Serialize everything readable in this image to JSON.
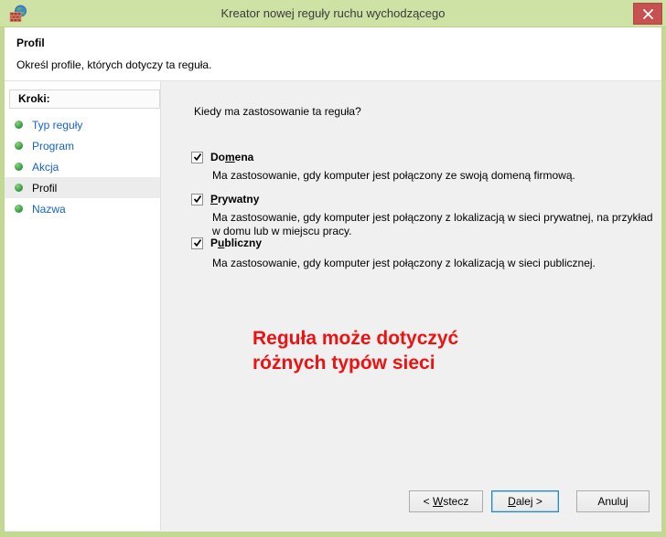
{
  "window": {
    "title": "Kreator nowej reguły ruchu wychodzącego"
  },
  "header": {
    "title": "Profil",
    "subtitle": "Określ profile, których dotyczy ta reguła."
  },
  "sidebar": {
    "heading": "Kroki:",
    "items": [
      {
        "label": "Typ reguły",
        "state": "link"
      },
      {
        "label": "Program",
        "state": "link"
      },
      {
        "label": "Akcja",
        "state": "link"
      },
      {
        "label": "Profil",
        "state": "current"
      },
      {
        "label": "Nazwa",
        "state": "link"
      }
    ]
  },
  "main": {
    "question": "Kiedy ma zastosowanie ta reguła?",
    "profiles": [
      {
        "label": "Domena",
        "label_pre": "Do",
        "label_accel": "m",
        "label_post": "ena",
        "checked": true,
        "description": "Ma zastosowanie, gdy komputer jest połączony ze swoją domeną firmową."
      },
      {
        "label": "Prywatny",
        "label_pre": "",
        "label_accel": "P",
        "label_post": "rywatny",
        "checked": true,
        "description": "Ma zastosowanie, gdy komputer jest połączony z lokalizacją w sieci prywatnej, na przykład w domu lub w miejscu pracy."
      },
      {
        "label": "Publiczny",
        "label_pre": "P",
        "label_accel": "u",
        "label_post": "bliczny",
        "checked": true,
        "description": "Ma zastosowanie, gdy komputer jest połączony z lokalizacją w sieci publicznej."
      }
    ],
    "annotation": {
      "line1": "Reguła może dotyczyć",
      "line2": "różnych typów sieci",
      "color": "#ee1111"
    }
  },
  "buttons": {
    "back": {
      "pre": "< ",
      "accel": "W",
      "post": "stecz"
    },
    "next": {
      "pre": "",
      "accel": "D",
      "post": "alej >"
    },
    "cancel": {
      "label": "Anuluj"
    }
  },
  "colors": {
    "titlebar": "#cfe2a5",
    "frame": "#c3d893",
    "close_button": "#c75050",
    "link_blue": "#1563c5",
    "bullet_green": "#3aa045",
    "annotation_red": "#ee1111",
    "main_background": "#f0f0f0"
  }
}
